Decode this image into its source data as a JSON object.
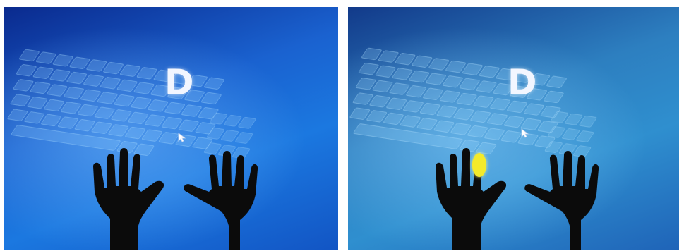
{
  "screens": [
    {
      "letter": "D",
      "highlight": null
    },
    {
      "letter": "D",
      "highlight": "left-middle-finger"
    }
  ],
  "colors": {
    "background_blue": "#1a62d0",
    "hand_silhouette": "#0b0b0b",
    "finger_highlight": "#f4ea2a",
    "letter": "#f2f6ff"
  }
}
